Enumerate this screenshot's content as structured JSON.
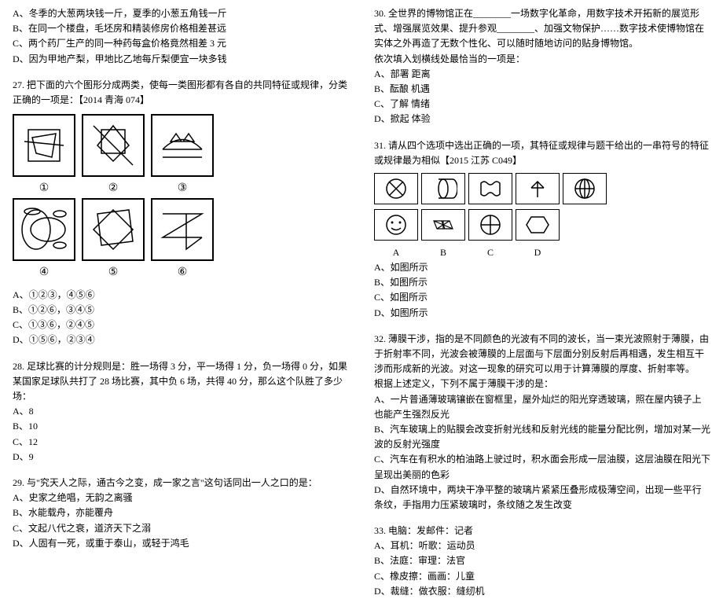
{
  "left": {
    "q26_opts": {
      "A": "A、冬季的大葱两块钱一斤，夏季的小葱五角钱一斤",
      "B": "B、在同一个楼盘，毛坯房和精装修房价格相差甚远",
      "C": "C、两个药厂生产的同一种药每盒价格竟然相差 3 元",
      "D": "D、因为甲地产梨，甲地比乙地每斤梨便宜一块多钱"
    },
    "q27_stem": "27. 把下面的六个图形分成两类，使每一类图形都有各自的共同特征或规律，分类正确的一项是：【2014 青海 074】",
    "q27_labels": [
      "①",
      "②",
      "③",
      "④",
      "⑤",
      "⑥"
    ],
    "q27_opts": {
      "A": "A、①②③，④⑤⑥",
      "B": "B、①②⑥，③④⑤",
      "C": "C、①③⑥，②④⑤",
      "D": "D、①⑤⑥，②③④"
    },
    "q28_stem": "28. 足球比赛的计分规则是：胜一场得 3 分，平一场得 1 分，负一场得 0 分，如果某国家足球队共打了 28 场比赛，其中负 6 场，共得 40 分，那么这个队胜了多少场：",
    "q28_opts": {
      "A": "A、8",
      "B": "B、10",
      "C": "C、12",
      "D": "D、9"
    },
    "q29_stem": "29. 与\"究天人之际，通古今之变，成一家之言\"这句话同出一人之口的是：",
    "q29_opts": {
      "A": "A、史家之绝唱，无韵之离骚",
      "B": "B、水能载舟，亦能覆舟",
      "C": "C、文起八代之衰，道济天下之溺",
      "D": "D、人固有一死，或重于泰山，或轻于鸿毛"
    }
  },
  "right": {
    "q30_stem": "30. 全世界的博物馆正在________一场数字化革命，用数字技术开拓新的展览形式、增强展览效果、提升参观________、加强文物保护……数字技术使博物馆在实体之外再造了无数个性化、可以随时随地访问的贴身博物馆。",
    "q30_prompt": "依次填入划横线处最恰当的一项是：",
    "q30_opts": {
      "A": "A、部署 距离",
      "B": "B、酝酿 机遇",
      "C": "C、了解 情绪",
      "D": "D、掀起 体验"
    },
    "q31_stem": "31. 请从四个选项中选出正确的一项，其特征或规律与题干给出的一串符号的特征或规律最为相似【2015 江苏 C049】",
    "q31_labels": [
      "A",
      "B",
      "C",
      "D"
    ],
    "q31_opts": {
      "A": "A、如图所示",
      "B": "B、如图所示",
      "C": "C、如图所示",
      "D": "D、如图所示"
    },
    "q32_stem": "32. 薄膜干涉，指的是不同颜色的光波有不同的波长，当一束光波照射于薄膜，由于折射率不同，光波会被薄膜的上层面与下层面分别反射后再相遇，发生相互干涉而形成新的光波。对这一现象的研究可以用于计算薄膜的厚度、折射率等。",
    "q32_prompt": "根据上述定义，下列不属于薄膜干涉的是：",
    "q32_opts": {
      "A": "A、一片普通薄玻璃镶嵌在窗框里，屋外灿烂的阳光穿透玻璃，照在屋内镜子上也能产生强烈反光",
      "B": "B、汽车玻璃上的贴膜会改变折射光线和反射光线的能量分配比例，增加对某一光波的反射光强度",
      "C": "C、汽车在有积水的柏油路上驶过时，积水面会形成一层油膜，这层油膜在阳光下呈现出美丽的色彩",
      "D": "D、自然环境中，两块干净平整的玻璃片紧紧压叠形成极薄空间，出现一些平行条纹，手指用力压紧玻璃时，条纹随之发生改变"
    },
    "q33_stem": "33. 电脑：发邮件：记者",
    "q33_opts": {
      "A": "A、耳机：听歌：运动员",
      "B": "B、法庭：审理：法官",
      "C": "C、橡皮擦：画画：儿童",
      "D": "D、裁缝：做衣服：缝纫机"
    }
  }
}
